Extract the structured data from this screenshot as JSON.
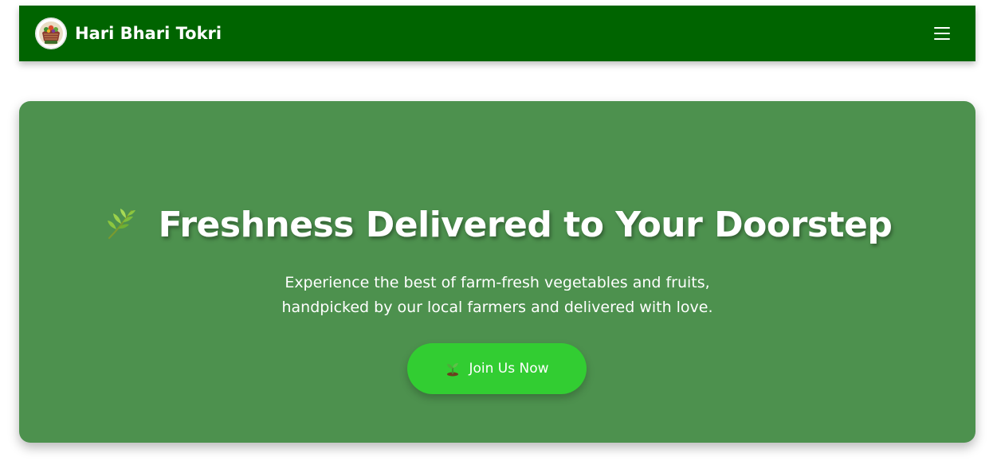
{
  "navbar": {
    "brand": "Hari Bhari Tokri",
    "logo_icon": "basket-logo-icon",
    "menu_icon": "hamburger-menu-icon",
    "background_color": "#006400"
  },
  "hero": {
    "title": "Freshness Delivered to Your Doorstep",
    "title_icon": "herb-leaf-icon",
    "subtitle_line1": "Experience the best of farm-fresh vegetables and fruits,",
    "subtitle_line2": "handpicked by our local farmers and delivered with love.",
    "cta_label": "Join Us Now",
    "cta_icon": "seedling-icon",
    "background_color": "#4d914e",
    "cta_color": "#32cd32"
  }
}
